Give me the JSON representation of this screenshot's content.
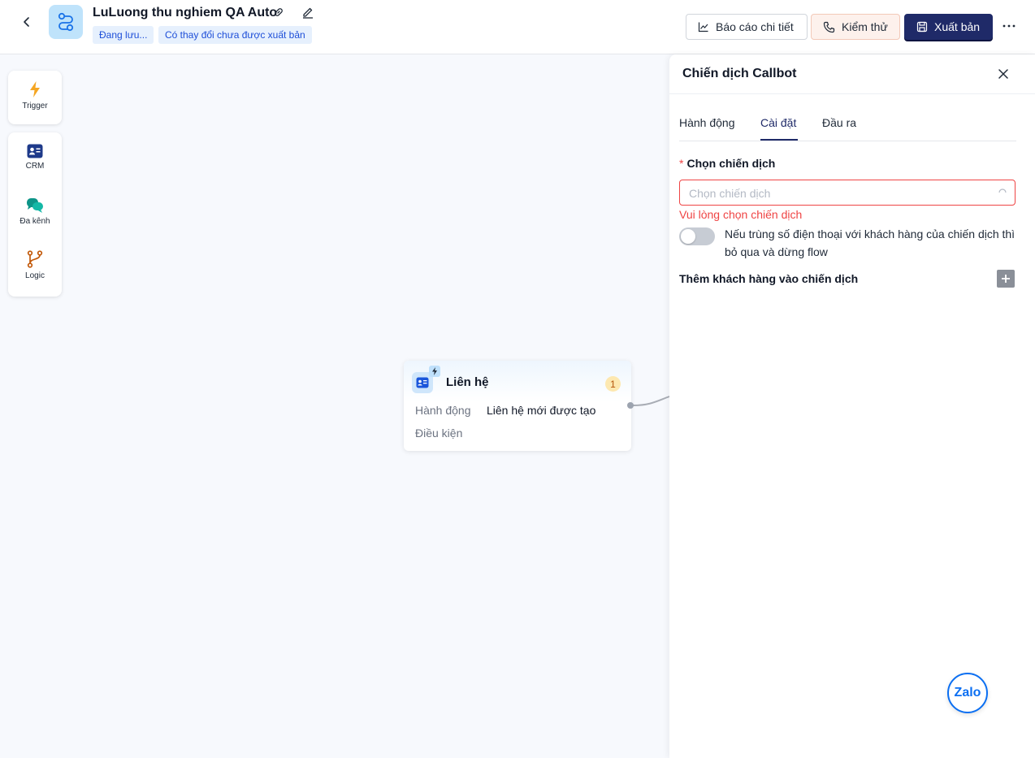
{
  "header": {
    "title": "LuLuong thu nghiem QA Auto",
    "status_saving": "Đang lưu...",
    "status_unpublished": "Có thay đổi chưa được xuất bản",
    "report_label": "Báo cáo chi tiết",
    "test_label": "Kiểm thử",
    "publish_label": "Xuất bản"
  },
  "toolbar": {
    "trigger_label": "Trigger",
    "crm_label": "CRM",
    "omnichannel_label": "Đa kênh",
    "logic_label": "Logic"
  },
  "node": {
    "title": "Liên hệ",
    "count": "1",
    "action_label": "Hành động",
    "action_value": "Liên hệ mới được tạo",
    "condition_label": "Điều kiện"
  },
  "panel": {
    "title": "Chiến dịch Callbot",
    "tabs": [
      {
        "label": "Hành động"
      },
      {
        "label": "Cài đặt"
      },
      {
        "label": "Đầu ra"
      }
    ],
    "active_tab": "Cài đặt",
    "campaign_label": "Chọn chiến dịch",
    "campaign_placeholder": "Chọn chiến dịch",
    "campaign_error": "Vui lòng chọn chiến dịch",
    "toggle_text": "Nếu trùng số điện thoại với khách hàng của chiến dịch thì bỏ qua và dừng flow",
    "toggle_on": false,
    "add_customers_label": "Thêm khách hàng vào chiến dịch"
  },
  "widget": {
    "zalo_label": "Zalo"
  },
  "colors": {
    "primary": "#1f2a68",
    "error": "#ef4444",
    "canvas": "#f7f9fd",
    "badge_bg": "#e6f0fd"
  }
}
